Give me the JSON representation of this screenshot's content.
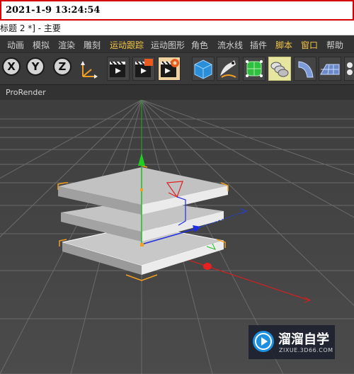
{
  "overlay": {
    "timestamp": "2021-1-9 13:24:54"
  },
  "window": {
    "title": "标题 2 *] - 主要"
  },
  "menu": {
    "items": [
      {
        "label": "动画",
        "highlight": false
      },
      {
        "label": "模拟",
        "highlight": false
      },
      {
        "label": "渲染",
        "highlight": false
      },
      {
        "label": "雕刻",
        "highlight": false
      },
      {
        "label": "运动跟踪",
        "highlight": true
      },
      {
        "label": "运动图形",
        "highlight": false
      },
      {
        "label": "角色",
        "highlight": false
      },
      {
        "label": "流水线",
        "highlight": false
      },
      {
        "label": "插件",
        "highlight": false
      },
      {
        "label": "脚本",
        "highlight": true
      },
      {
        "label": "窗口",
        "highlight": true
      },
      {
        "label": "帮助",
        "highlight": false
      }
    ]
  },
  "toolbar": {
    "axis": [
      {
        "label": "X"
      },
      {
        "label": "Y"
      },
      {
        "label": "Z"
      }
    ],
    "tools": [
      {
        "icon": "coordinate-system-icon"
      },
      {
        "icon": "render-view-icon"
      },
      {
        "icon": "render-to-picture-viewer-icon"
      },
      {
        "icon": "render-settings-icon"
      },
      {
        "icon": "cube-primitive-icon"
      },
      {
        "icon": "pen-spline-icon"
      },
      {
        "icon": "subdivision-surface-icon"
      },
      {
        "icon": "array-cloner-icon"
      },
      {
        "icon": "deformer-bend-icon"
      },
      {
        "icon": "floor-plane-icon"
      },
      {
        "icon": "camera-icon"
      }
    ]
  },
  "panel": {
    "label": "ProRender"
  },
  "watermark": {
    "title": "溜溜自学",
    "subtitle": "ZIXUE.3D66.COM",
    "icon": "play-icon"
  },
  "colors": {
    "highlight_text": "#f2c646",
    "timestamp_border": "#d40000",
    "axis_x": "#e02020",
    "axis_y": "#20c020",
    "axis_z": "#2040e0",
    "selection": "#f0a020"
  }
}
